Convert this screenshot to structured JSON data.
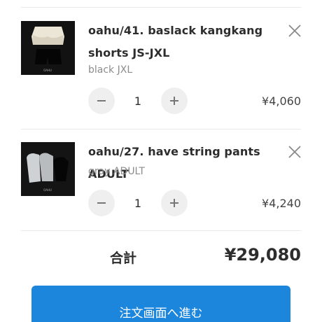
{
  "cart": {
    "items": [
      {
        "name": "oahu/41. baslack kangkang shorts JS-JXL",
        "variant": "black JXL",
        "quantity": "1",
        "price": "¥4,060",
        "thumb_caption": "OAHU"
      },
      {
        "name": "oahu/27. have string pants ADULT",
        "variant": "gray ADULT",
        "quantity": "1",
        "price": "¥4,240",
        "thumb_caption": "OAHU"
      }
    ],
    "total_label": "合計",
    "total_value": "¥29,080",
    "checkout_label": "注文画面へ進む"
  },
  "icons": {
    "remove": "close-icon",
    "decrement": "minus-icon",
    "increment": "plus-icon"
  },
  "colors": {
    "accent": "#1c86dd",
    "button_bg": "#efefef",
    "muted_text": "#8c8c8c"
  }
}
